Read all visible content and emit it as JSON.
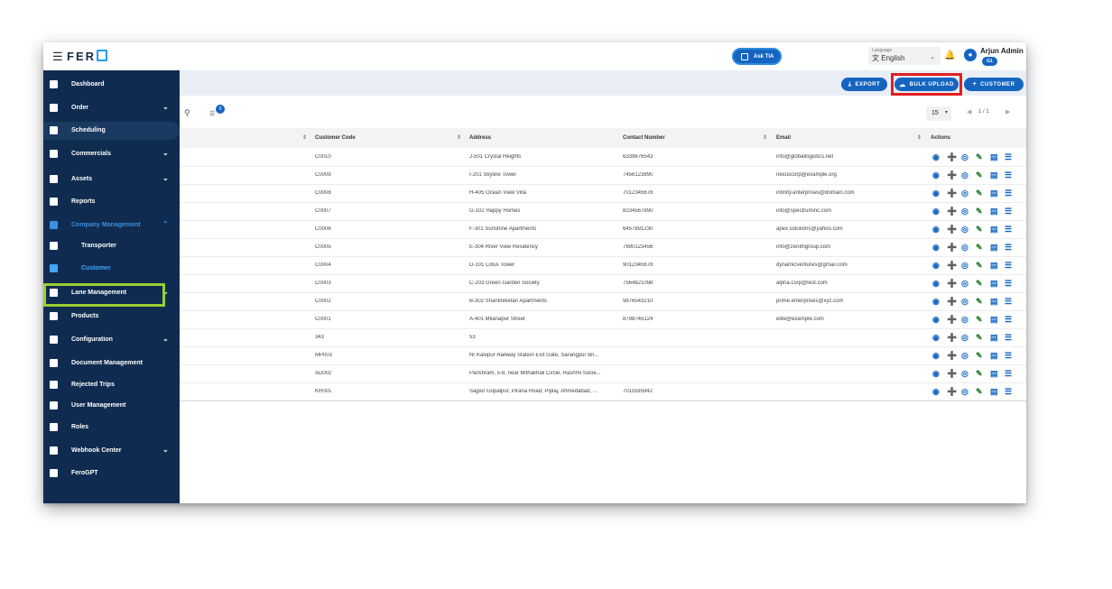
{
  "app": {
    "logo": "FER",
    "ask_label": "Ask TIA"
  },
  "language": {
    "caption": "Language",
    "value": "English"
  },
  "user": {
    "name": "Arjun Admin",
    "badge": "G1"
  },
  "sidebar": {
    "items": [
      {
        "label": "Dashboard"
      },
      {
        "label": "Order"
      },
      {
        "label": "Scheduling"
      },
      {
        "label": "Commercials"
      },
      {
        "label": "Assets"
      },
      {
        "label": "Reports"
      },
      {
        "label": "Company Management"
      },
      {
        "label": "Transporter"
      },
      {
        "label": "Customer"
      },
      {
        "label": "Lane Management"
      },
      {
        "label": "Products"
      },
      {
        "label": "Configuration"
      },
      {
        "label": "Document Management"
      },
      {
        "label": "Rejected Trips"
      },
      {
        "label": "User Management"
      },
      {
        "label": "Roles"
      },
      {
        "label": "Webhook Center"
      },
      {
        "label": "FeroGPT"
      }
    ]
  },
  "toolbar": {
    "export_label": "EXPORT",
    "bulk_upload_label": "BULK UPLOAD",
    "customer_label": "CUSTOMER"
  },
  "filter_count": "0",
  "pagination": {
    "per_page": "15",
    "info": "1 / 1"
  },
  "table": {
    "headers": [
      "Customer Code",
      "Address",
      "Contact Number",
      "Email",
      "Actions"
    ],
    "rows": [
      [
        "C0010",
        "J-501 Crystal Heights",
        "6339676543",
        "info@globallogistics.net"
      ],
      [
        "C0009",
        "I-201 Skyline Tower",
        "7456123890",
        "nexuscorp@example.org"
      ],
      [
        "C0008",
        "H-405 Ocean View Villa",
        "7012345678",
        "infinity.enterprises@domain.com"
      ],
      [
        "C0007",
        "G-102 Happy Homes",
        "8234567890",
        "info@spectruminc.com"
      ],
      [
        "C0006",
        "F-301 Sunshine Apartments",
        "6457891230",
        "apex.solutions@yahoo.com"
      ],
      [
        "C0005",
        "E-304 River View Residency",
        "7690123456",
        "info@zenithgroup.com"
      ],
      [
        "C0004",
        "D-101 Lotus Tower",
        "9012345678",
        "dynamicventures@gmail.com"
      ],
      [
        "C0003",
        "C-203 Green Garden Society",
        "7564821098",
        "alpha.corp@test.com"
      ],
      [
        "C0002",
        "B-302 Shantiniketan Apartments",
        "9876543210",
        "prime.enterprises@xyz.com"
      ],
      [
        "C0001",
        "A-401 Milanapur Street",
        "8798745124",
        "elite@example.com"
      ],
      [
        "343",
        "53",
        "",
        ""
      ],
      [
        "MP003",
        "Nr Kalupur Railway Station Exit Gate, Sarangpur Bri...",
        "",
        ""
      ],
      [
        "AD002",
        "Parishram, 5-8, near Mithakhali Circle, Rashmi Socie...",
        "",
        ""
      ],
      [
        "KR001",
        "Sajpur Gopalpur, Pirana Road, Piplaj, Ahmedabad, ...",
        "7011595942",
        ""
      ]
    ]
  }
}
